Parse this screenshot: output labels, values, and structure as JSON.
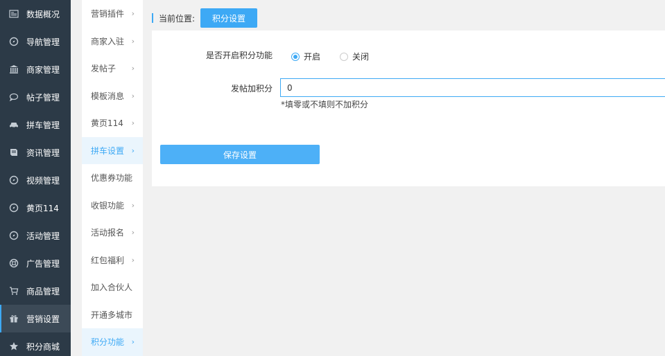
{
  "sidebar": {
    "items": [
      {
        "label": "数据概况",
        "icon": "dashboard-icon"
      },
      {
        "label": "导航管理",
        "icon": "compass-icon"
      },
      {
        "label": "商家管理",
        "icon": "bank-icon"
      },
      {
        "label": "帖子管理",
        "icon": "chat-icon"
      },
      {
        "label": "拼车管理",
        "icon": "car-icon"
      },
      {
        "label": "资讯管理",
        "icon": "book-icon"
      },
      {
        "label": "视频管理",
        "icon": "compass-icon"
      },
      {
        "label": "黄页114",
        "icon": "compass-icon"
      },
      {
        "label": "活动管理",
        "icon": "compass-icon"
      },
      {
        "label": "广告管理",
        "icon": "lifebuoy-icon"
      },
      {
        "label": "商品管理",
        "icon": "cart-icon"
      },
      {
        "label": "营销设置",
        "icon": "gift-icon"
      },
      {
        "label": "积分商城",
        "icon": "star-icon"
      }
    ],
    "active_index": 11
  },
  "submenu": {
    "items": [
      {
        "label": "营销插件",
        "chevron": "›"
      },
      {
        "label": "商家入驻",
        "chevron": "›"
      },
      {
        "label": "发帖子",
        "chevron": "›"
      },
      {
        "label": "模板消息",
        "chevron": "›"
      },
      {
        "label": "黄页114",
        "chevron": "›"
      },
      {
        "label": "拼车设置",
        "chevron": "›"
      },
      {
        "label": "优惠券功能",
        "chevron": ""
      },
      {
        "label": "收银功能",
        "chevron": "›"
      },
      {
        "label": "活动报名",
        "chevron": "›"
      },
      {
        "label": "红包福利",
        "chevron": "›"
      },
      {
        "label": "加入合伙人",
        "chevron": ""
      },
      {
        "label": "开通多城市",
        "chevron": ""
      },
      {
        "label": "积分功能",
        "chevron": "›"
      }
    ],
    "active_indices": [
      5,
      12
    ]
  },
  "breadcrumb": {
    "label": "当前位置:",
    "current": "积分设置"
  },
  "form": {
    "enable_label": "是否开启积分功能",
    "options": [
      "开启",
      "关闭"
    ],
    "selected": "开启",
    "points_label": "发帖加积分",
    "points_value": "0",
    "points_hint": "*填零或不填则不加积分",
    "save_label": "保存设置"
  },
  "colors": {
    "accent": "#3da9f5",
    "sidebar_bg": "#2c3a47"
  }
}
